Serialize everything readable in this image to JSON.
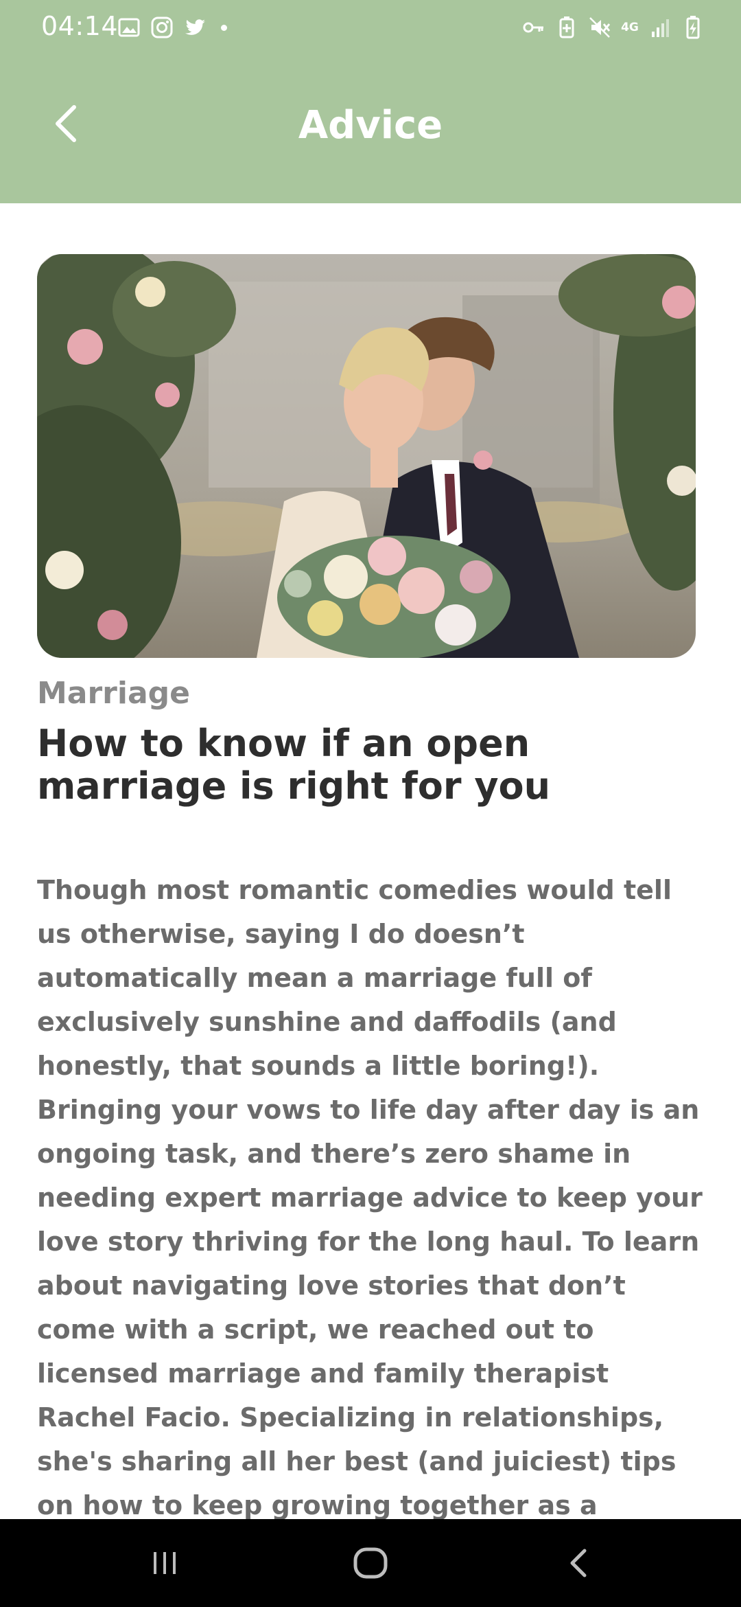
{
  "status_bar": {
    "time": "04:14",
    "network_label": "4G",
    "left_icons": [
      "gallery-icon",
      "instagram-icon",
      "twitter-icon",
      "notification-dot"
    ],
    "right_icons": [
      "vpn-key-icon",
      "battery-saver-icon",
      "mute-icon",
      "network-icon",
      "signal-icon",
      "battery-icon"
    ]
  },
  "app_bar": {
    "title": "Advice",
    "back_icon": "chevron-left-icon",
    "background": "#a9c69d"
  },
  "article": {
    "image_alt": "Bride and groom holding a flower bouquet under a floral arch",
    "category": "Marriage",
    "title": "How to know if an open marriage is right for you",
    "body": "Though most romantic comedies would tell us otherwise, saying I do doesn’t automatically mean a marriage full of exclusively sunshine and daffodils (and honestly, that sounds a little boring!). Bringing your vows to life day after day is an ongoing task, and there’s zero shame in needing expert marriage advice to keep your love story thriving for the long haul. To learn about navigating love stories that don’t come with a script, we reached out to licensed marriage and family therapist Rachel Facio. Specializing in relationships, she's sharing all her best (and juiciest) tips on how to keep growing together as a couple."
  },
  "nav_bar": {
    "buttons": [
      "recents-icon",
      "home-icon",
      "back-icon"
    ]
  }
}
